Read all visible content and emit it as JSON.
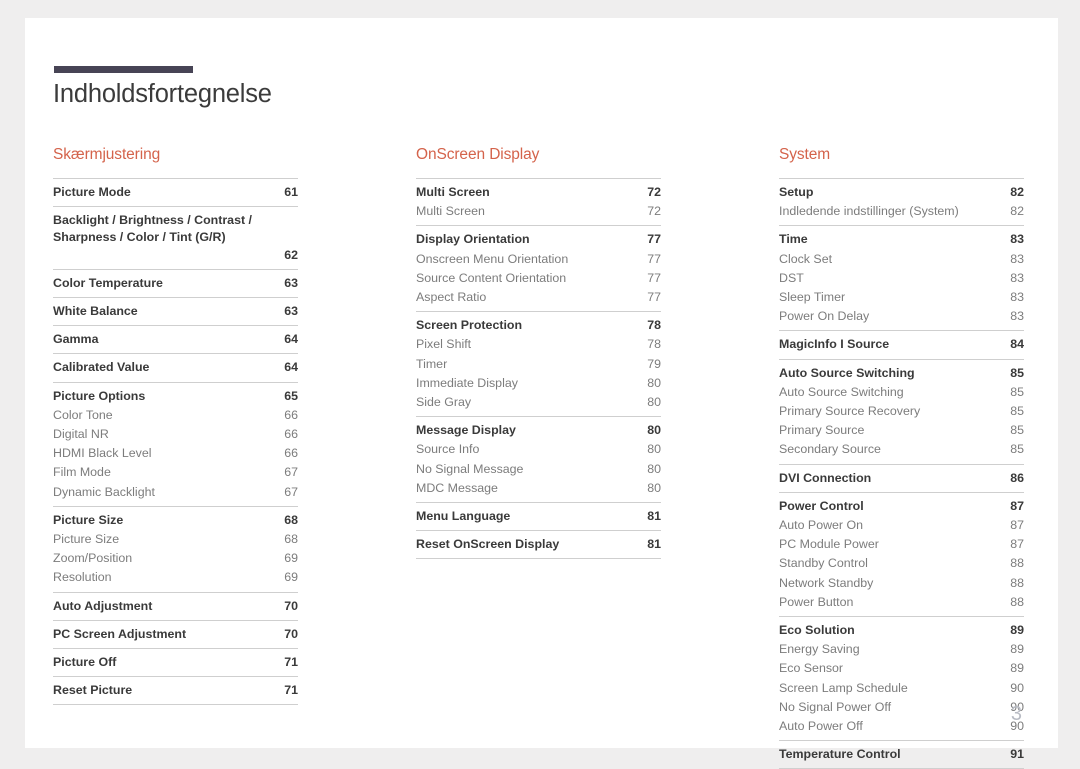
{
  "document": {
    "title": "Indholdsfortegnelse",
    "page_number": "3",
    "accent_color": "#d4634b",
    "rule_color": "#474455"
  },
  "columns": [
    {
      "heading": "Skærmjustering",
      "groups": [
        {
          "entries": [
            {
              "label": "Picture Mode",
              "page": "61",
              "level": "head",
              "wrap": false
            }
          ]
        },
        {
          "entries": [
            {
              "label": "Backlight / Brightness / Contrast / Sharpness / Color / Tint (G/R)",
              "page": "62",
              "level": "head",
              "wrap": true
            }
          ]
        },
        {
          "entries": [
            {
              "label": "Color Temperature",
              "page": "63",
              "level": "head",
              "wrap": false
            }
          ]
        },
        {
          "entries": [
            {
              "label": "White Balance",
              "page": "63",
              "level": "head",
              "wrap": false
            }
          ]
        },
        {
          "entries": [
            {
              "label": "Gamma",
              "page": "64",
              "level": "head",
              "wrap": false
            }
          ]
        },
        {
          "entries": [
            {
              "label": "Calibrated Value",
              "page": "64",
              "level": "head",
              "wrap": false
            }
          ]
        },
        {
          "entries": [
            {
              "label": "Picture Options",
              "page": "65",
              "level": "head",
              "wrap": false
            },
            {
              "label": "Color Tone",
              "page": "66",
              "level": "sub",
              "wrap": false
            },
            {
              "label": "Digital NR",
              "page": "66",
              "level": "sub",
              "wrap": false
            },
            {
              "label": "HDMI Black Level",
              "page": "66",
              "level": "sub",
              "wrap": false
            },
            {
              "label": "Film Mode",
              "page": "67",
              "level": "sub",
              "wrap": false
            },
            {
              "label": "Dynamic Backlight",
              "page": "67",
              "level": "sub",
              "wrap": false
            }
          ]
        },
        {
          "entries": [
            {
              "label": "Picture Size",
              "page": "68",
              "level": "head",
              "wrap": false
            },
            {
              "label": "Picture Size",
              "page": "68",
              "level": "sub",
              "wrap": false
            },
            {
              "label": "Zoom/Position",
              "page": "69",
              "level": "sub",
              "wrap": false
            },
            {
              "label": "Resolution",
              "page": "69",
              "level": "sub",
              "wrap": false
            }
          ]
        },
        {
          "entries": [
            {
              "label": "Auto Adjustment",
              "page": "70",
              "level": "head",
              "wrap": false
            }
          ]
        },
        {
          "entries": [
            {
              "label": "PC Screen Adjustment",
              "page": "70",
              "level": "head",
              "wrap": false
            }
          ]
        },
        {
          "entries": [
            {
              "label": "Picture Off",
              "page": "71",
              "level": "head",
              "wrap": false
            }
          ]
        },
        {
          "entries": [
            {
              "label": "Reset Picture",
              "page": "71",
              "level": "head",
              "wrap": false
            }
          ]
        }
      ]
    },
    {
      "heading": "OnScreen Display",
      "groups": [
        {
          "entries": [
            {
              "label": "Multi Screen",
              "page": "72",
              "level": "head",
              "wrap": false
            },
            {
              "label": "Multi Screen",
              "page": "72",
              "level": "sub",
              "wrap": false
            }
          ]
        },
        {
          "entries": [
            {
              "label": "Display Orientation",
              "page": "77",
              "level": "head",
              "wrap": false
            },
            {
              "label": "Onscreen Menu Orientation",
              "page": "77",
              "level": "sub",
              "wrap": false
            },
            {
              "label": "Source Content Orientation",
              "page": "77",
              "level": "sub",
              "wrap": false
            },
            {
              "label": "Aspect Ratio",
              "page": "77",
              "level": "sub",
              "wrap": false
            }
          ]
        },
        {
          "entries": [
            {
              "label": "Screen Protection",
              "page": "78",
              "level": "head",
              "wrap": false
            },
            {
              "label": "Pixel Shift",
              "page": "78",
              "level": "sub",
              "wrap": false
            },
            {
              "label": "Timer",
              "page": "79",
              "level": "sub",
              "wrap": false
            },
            {
              "label": "Immediate Display",
              "page": "80",
              "level": "sub",
              "wrap": false
            },
            {
              "label": "Side Gray",
              "page": "80",
              "level": "sub",
              "wrap": false
            }
          ]
        },
        {
          "entries": [
            {
              "label": "Message Display",
              "page": "80",
              "level": "head",
              "wrap": false
            },
            {
              "label": "Source Info",
              "page": "80",
              "level": "sub",
              "wrap": false
            },
            {
              "label": "No Signal Message",
              "page": "80",
              "level": "sub",
              "wrap": false
            },
            {
              "label": "MDC Message",
              "page": "80",
              "level": "sub",
              "wrap": false
            }
          ]
        },
        {
          "entries": [
            {
              "label": "Menu Language",
              "page": "81",
              "level": "head",
              "wrap": false
            }
          ]
        },
        {
          "entries": [
            {
              "label": "Reset OnScreen Display",
              "page": "81",
              "level": "head",
              "wrap": false
            }
          ]
        }
      ]
    },
    {
      "heading": "System",
      "groups": [
        {
          "entries": [
            {
              "label": "Setup",
              "page": "82",
              "level": "head",
              "wrap": false
            },
            {
              "label": "Indledende indstillinger (System)",
              "page": "82",
              "level": "sub",
              "wrap": false
            }
          ]
        },
        {
          "entries": [
            {
              "label": "Time",
              "page": "83",
              "level": "head",
              "wrap": false
            },
            {
              "label": "Clock Set",
              "page": "83",
              "level": "sub",
              "wrap": false
            },
            {
              "label": "DST",
              "page": "83",
              "level": "sub",
              "wrap": false
            },
            {
              "label": "Sleep Timer",
              "page": "83",
              "level": "sub",
              "wrap": false
            },
            {
              "label": "Power On Delay",
              "page": "83",
              "level": "sub",
              "wrap": false
            }
          ]
        },
        {
          "entries": [
            {
              "label": "MagicInfo I Source",
              "page": "84",
              "level": "head",
              "wrap": false
            }
          ]
        },
        {
          "entries": [
            {
              "label": "Auto Source Switching",
              "page": "85",
              "level": "head",
              "wrap": false
            },
            {
              "label": "Auto Source Switching",
              "page": "85",
              "level": "sub",
              "wrap": false
            },
            {
              "label": "Primary Source Recovery",
              "page": "85",
              "level": "sub",
              "wrap": false
            },
            {
              "label": "Primary Source",
              "page": "85",
              "level": "sub",
              "wrap": false
            },
            {
              "label": "Secondary Source",
              "page": "85",
              "level": "sub",
              "wrap": false
            }
          ]
        },
        {
          "entries": [
            {
              "label": "DVI Connection",
              "page": "86",
              "level": "head",
              "wrap": false
            }
          ]
        },
        {
          "entries": [
            {
              "label": "Power Control",
              "page": "87",
              "level": "head",
              "wrap": false
            },
            {
              "label": "Auto Power On",
              "page": "87",
              "level": "sub",
              "wrap": false
            },
            {
              "label": "PC Module Power",
              "page": "87",
              "level": "sub",
              "wrap": false
            },
            {
              "label": "Standby Control",
              "page": "88",
              "level": "sub",
              "wrap": false
            },
            {
              "label": "Network Standby",
              "page": "88",
              "level": "sub",
              "wrap": false
            },
            {
              "label": "Power Button",
              "page": "88",
              "level": "sub",
              "wrap": false
            }
          ]
        },
        {
          "entries": [
            {
              "label": "Eco Solution",
              "page": "89",
              "level": "head",
              "wrap": false
            },
            {
              "label": "Energy Saving",
              "page": "89",
              "level": "sub",
              "wrap": false
            },
            {
              "label": "Eco Sensor",
              "page": "89",
              "level": "sub",
              "wrap": false
            },
            {
              "label": "Screen Lamp Schedule",
              "page": "90",
              "level": "sub",
              "wrap": false
            },
            {
              "label": "No Signal Power Off",
              "page": "90",
              "level": "sub",
              "wrap": false
            },
            {
              "label": "Auto Power Off",
              "page": "90",
              "level": "sub",
              "wrap": false
            }
          ]
        },
        {
          "entries": [
            {
              "label": "Temperature Control",
              "page": "91",
              "level": "head",
              "wrap": false
            }
          ]
        }
      ]
    }
  ]
}
